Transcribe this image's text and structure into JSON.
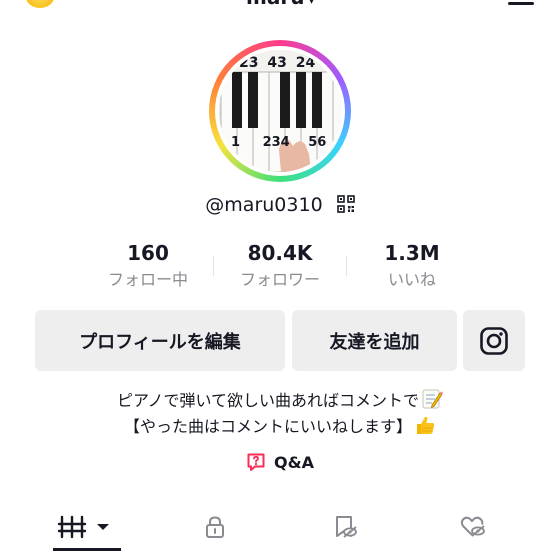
{
  "header": {
    "username": "maru",
    "chevron": "▾",
    "coin_icon": "coin-icon",
    "menu_icon": "hamburger-menu-icon"
  },
  "avatar": {
    "ring_colors": [
      "#ff3b8d",
      "#a259ff",
      "#3ad3ff",
      "#3de07a",
      "#f7e23b",
      "#ff7a3b"
    ],
    "key_numbers_top": [
      "23",
      "43",
      "24"
    ],
    "key_numbers_bottom": [
      "1",
      "234",
      "56"
    ]
  },
  "profile": {
    "handle": "@maru0310",
    "qr_icon": "qr-code-icon"
  },
  "stats": [
    {
      "value": "160",
      "label": "フォロー中"
    },
    {
      "value": "80.4K",
      "label": "フォロワー"
    },
    {
      "value": "1.3M",
      "label": "いいね"
    }
  ],
  "actions": {
    "edit_profile": "プロフィールを編集",
    "add_friends": "友達を追加",
    "instagram_icon": "instagram-icon"
  },
  "bio": {
    "line1": "ピアノで弾いて欲しい曲あればコメントで",
    "line1_emoji": "memo-icon",
    "line2": "【やった曲はコメントにいいねします】",
    "line2_emoji": "thumbs-up-icon"
  },
  "qa": {
    "label": "Q&A",
    "icon": "question-bubble-icon",
    "icon_color": "#fe2c55"
  },
  "tabs": [
    {
      "icon": "grid-videos-icon",
      "active": true
    },
    {
      "icon": "lock-icon",
      "active": false
    },
    {
      "icon": "hidden-bookmark-icon",
      "active": false
    },
    {
      "icon": "hidden-heart-icon",
      "active": false
    }
  ],
  "colors": {
    "text": "#161823",
    "muted": "#8a8b91",
    "button_bg": "#eeeeef",
    "accent": "#fe2c55"
  }
}
